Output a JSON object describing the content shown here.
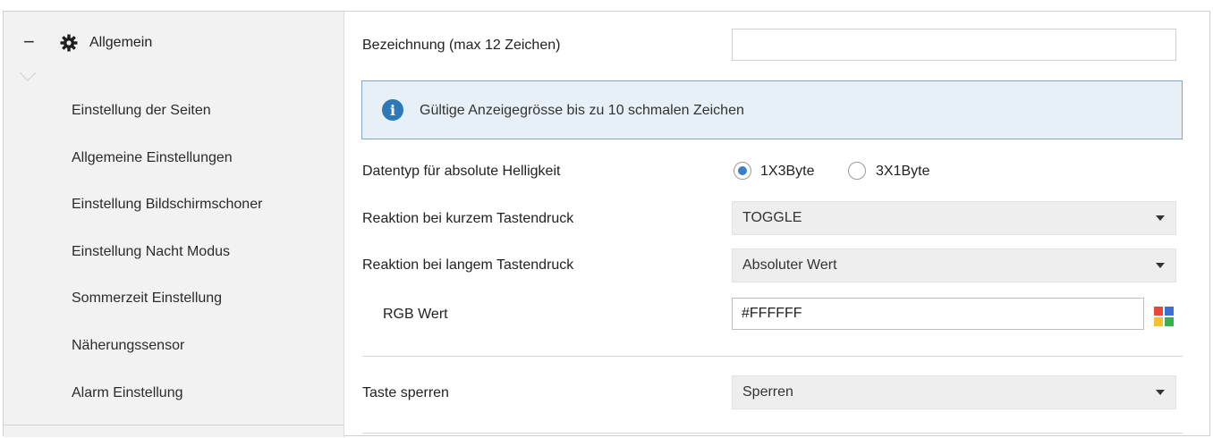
{
  "sidebar": {
    "header": {
      "label": "Allgemein",
      "collapse_glyph": "−",
      "icon": "gear-icon"
    },
    "items": [
      {
        "label": "Einstellung der Seiten"
      },
      {
        "label": "Allgemeine Einstellungen"
      },
      {
        "label": "Einstellung Bildschirmschoner"
      },
      {
        "label": "Einstellung Nacht Modus"
      },
      {
        "label": "Sommerzeit Einstellung"
      },
      {
        "label": "Näherungssensor"
      },
      {
        "label": "Alarm Einstellung"
      }
    ]
  },
  "main": {
    "bezeichnung": {
      "label": "Bezeichnung (max 12 Zeichen)",
      "value": ""
    },
    "info": {
      "icon_glyph": "i",
      "text": "Gültige Anzeigegrösse bis zu 10 schmalen Zeichen"
    },
    "datentyp": {
      "label": "Datentyp für absolute Helligkeit",
      "options": [
        {
          "label": "1X3Byte",
          "selected": true
        },
        {
          "label": "3X1Byte",
          "selected": false
        }
      ]
    },
    "kurz": {
      "label": "Reaktion bei kurzem Tastendruck",
      "value": "TOGGLE"
    },
    "lang": {
      "label": "Reaktion bei langem Tastendruck",
      "value": "Absoluter Wert"
    },
    "rgb": {
      "label": "RGB Wert",
      "value": "#FFFFFF",
      "palette_colors": [
        "#e8473b",
        "#3b6fd6",
        "#f2c233",
        "#3cae4d"
      ]
    },
    "taste": {
      "label": "Taste sperren",
      "value": "Sperren"
    }
  },
  "colors": {
    "accent": "#3b80c4",
    "info_bg": "#e6f0f6",
    "info_border": "#7fa7c2",
    "sidebar_bg": "#f2f2f2"
  }
}
